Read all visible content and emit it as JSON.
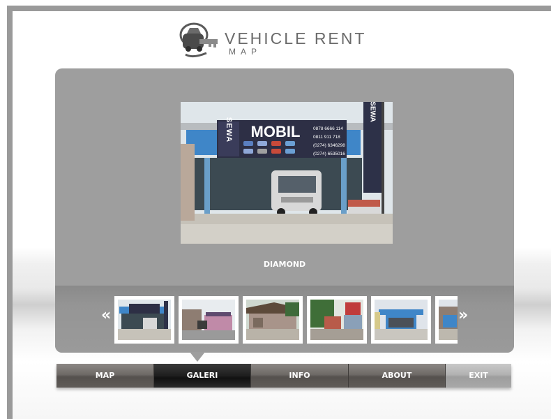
{
  "header": {
    "title": "VEHICLE RENT",
    "subtitle": "MAP"
  },
  "gallery": {
    "caption": "DIAMOND",
    "photo": {
      "sign_vertical": "SEWA",
      "sign_main": "MOBIL",
      "phone_lines": [
        "0878 6666 114",
        "0811 911 718",
        "(0274) 6346298",
        "(0274) 6535016"
      ],
      "pole_sign": "SEWA"
    },
    "prev_label": "«",
    "next_label": "»"
  },
  "nav": {
    "items": [
      {
        "label": "MAP"
      },
      {
        "label": "GALERI"
      },
      {
        "label": "INFO"
      },
      {
        "label": "ABOUT"
      },
      {
        "label": "EXIT"
      }
    ],
    "active": "GALERI"
  },
  "colors": {
    "panel": "#9e9e9e",
    "frame": "#9a9a9a",
    "logo_text": "#6b6b6b",
    "nav_active": "#1e1e1e",
    "building_blue": "#3f86c8"
  },
  "icons": {
    "logo": "car-key-icon",
    "prev": "double-chevron-left-icon",
    "next": "double-chevron-right-icon"
  }
}
